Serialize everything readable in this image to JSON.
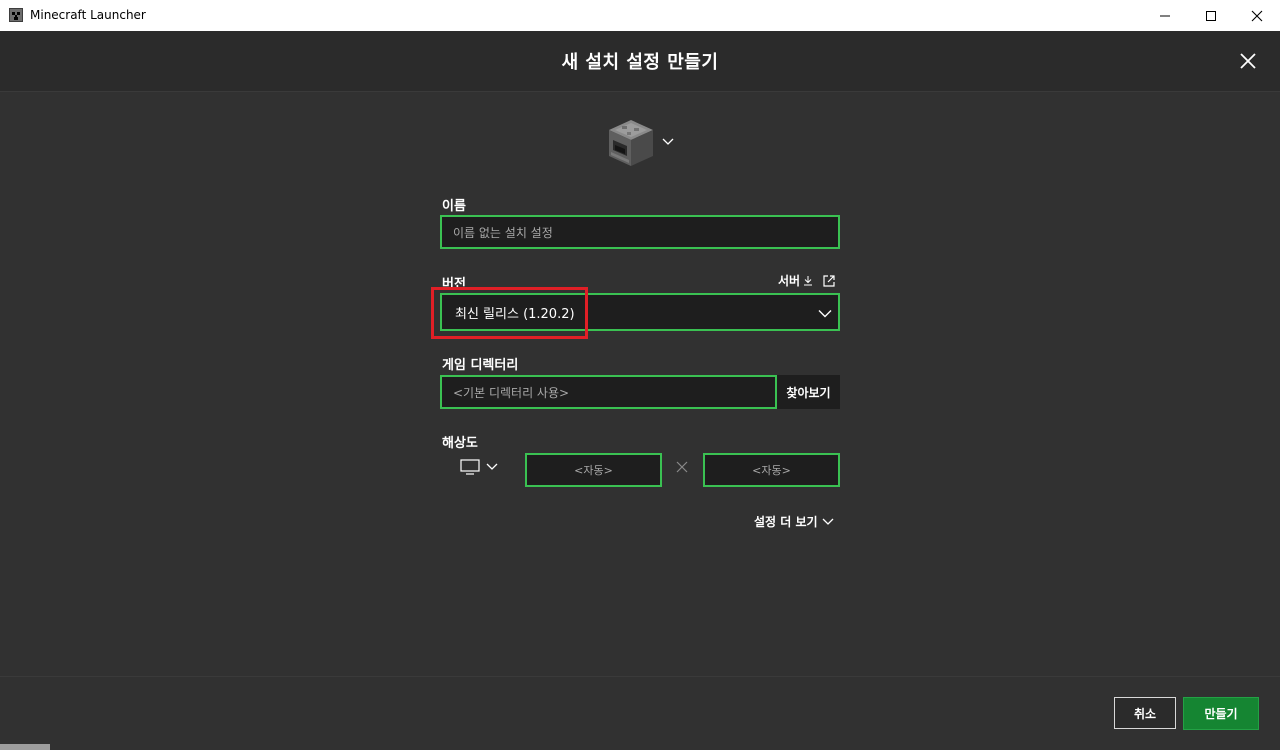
{
  "window": {
    "title": "Minecraft Launcher"
  },
  "dialog": {
    "title": "새 설치 설정 만들기"
  },
  "icon_picker": {
    "icon": "furnace-icon"
  },
  "name_field": {
    "label": "이름",
    "placeholder": "이름 없는 설치 설정"
  },
  "version_field": {
    "label": "버전",
    "selected": "최신 릴리스 (1.20.2)",
    "server_link": "서버"
  },
  "directory_field": {
    "label": "게임 디렉터리",
    "placeholder": "<기본 디렉터리 사용>",
    "browse_label": "찾아보기"
  },
  "resolution": {
    "label": "해상도",
    "width_placeholder": "<자동>",
    "height_placeholder": "<자동>"
  },
  "more_settings": "설정 더 보기",
  "footer": {
    "cancel_label": "취소",
    "create_label": "만들기"
  },
  "colors": {
    "accent_green": "#3ac152",
    "create_button": "#158532",
    "highlight": "#e01f26",
    "background": "#313131"
  }
}
